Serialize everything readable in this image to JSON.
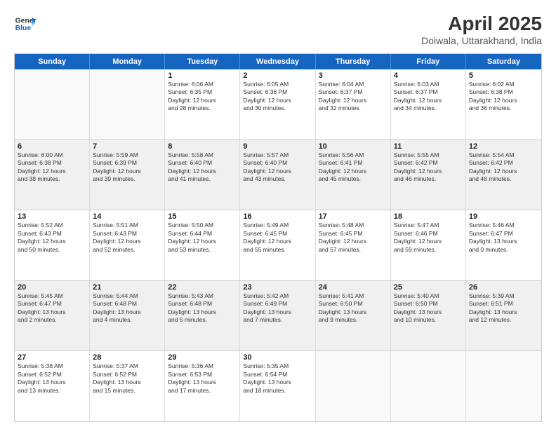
{
  "logo": {
    "line1": "General",
    "line2": "Blue"
  },
  "title": "April 2025",
  "subtitle": "Doiwala, Uttarakhand, India",
  "days": [
    "Sunday",
    "Monday",
    "Tuesday",
    "Wednesday",
    "Thursday",
    "Friday",
    "Saturday"
  ],
  "rows": [
    [
      {
        "day": "",
        "info": "",
        "empty": true
      },
      {
        "day": "",
        "info": "",
        "empty": true
      },
      {
        "day": "1",
        "info": "Sunrise: 6:06 AM\nSunset: 6:35 PM\nDaylight: 12 hours\nand 28 minutes."
      },
      {
        "day": "2",
        "info": "Sunrise: 6:05 AM\nSunset: 6:36 PM\nDaylight: 12 hours\nand 30 minutes."
      },
      {
        "day": "3",
        "info": "Sunrise: 6:04 AM\nSunset: 6:37 PM\nDaylight: 12 hours\nand 32 minutes."
      },
      {
        "day": "4",
        "info": "Sunrise: 6:03 AM\nSunset: 6:37 PM\nDaylight: 12 hours\nand 34 minutes."
      },
      {
        "day": "5",
        "info": "Sunrise: 6:02 AM\nSunset: 6:38 PM\nDaylight: 12 hours\nand 36 minutes."
      }
    ],
    [
      {
        "day": "6",
        "info": "Sunrise: 6:00 AM\nSunset: 6:38 PM\nDaylight: 12 hours\nand 38 minutes.",
        "shaded": true
      },
      {
        "day": "7",
        "info": "Sunrise: 5:59 AM\nSunset: 6:39 PM\nDaylight: 12 hours\nand 39 minutes.",
        "shaded": true
      },
      {
        "day": "8",
        "info": "Sunrise: 5:58 AM\nSunset: 6:40 PM\nDaylight: 12 hours\nand 41 minutes.",
        "shaded": true
      },
      {
        "day": "9",
        "info": "Sunrise: 5:57 AM\nSunset: 6:40 PM\nDaylight: 12 hours\nand 43 minutes.",
        "shaded": true
      },
      {
        "day": "10",
        "info": "Sunrise: 5:56 AM\nSunset: 6:41 PM\nDaylight: 12 hours\nand 45 minutes.",
        "shaded": true
      },
      {
        "day": "11",
        "info": "Sunrise: 5:55 AM\nSunset: 6:42 PM\nDaylight: 12 hours\nand 46 minutes.",
        "shaded": true
      },
      {
        "day": "12",
        "info": "Sunrise: 5:54 AM\nSunset: 6:42 PM\nDaylight: 12 hours\nand 48 minutes.",
        "shaded": true
      }
    ],
    [
      {
        "day": "13",
        "info": "Sunrise: 5:52 AM\nSunset: 6:43 PM\nDaylight: 12 hours\nand 50 minutes."
      },
      {
        "day": "14",
        "info": "Sunrise: 5:51 AM\nSunset: 6:43 PM\nDaylight: 12 hours\nand 52 minutes."
      },
      {
        "day": "15",
        "info": "Sunrise: 5:50 AM\nSunset: 6:44 PM\nDaylight: 12 hours\nand 53 minutes."
      },
      {
        "day": "16",
        "info": "Sunrise: 5:49 AM\nSunset: 6:45 PM\nDaylight: 12 hours\nand 55 minutes."
      },
      {
        "day": "17",
        "info": "Sunrise: 5:48 AM\nSunset: 6:45 PM\nDaylight: 12 hours\nand 57 minutes."
      },
      {
        "day": "18",
        "info": "Sunrise: 5:47 AM\nSunset: 6:46 PM\nDaylight: 12 hours\nand 59 minutes."
      },
      {
        "day": "19",
        "info": "Sunrise: 5:46 AM\nSunset: 6:47 PM\nDaylight: 13 hours\nand 0 minutes."
      }
    ],
    [
      {
        "day": "20",
        "info": "Sunrise: 5:45 AM\nSunset: 6:47 PM\nDaylight: 13 hours\nand 2 minutes.",
        "shaded": true
      },
      {
        "day": "21",
        "info": "Sunrise: 5:44 AM\nSunset: 6:48 PM\nDaylight: 13 hours\nand 4 minutes.",
        "shaded": true
      },
      {
        "day": "22",
        "info": "Sunrise: 5:43 AM\nSunset: 6:48 PM\nDaylight: 13 hours\nand 5 minutes.",
        "shaded": true
      },
      {
        "day": "23",
        "info": "Sunrise: 5:42 AM\nSunset: 6:49 PM\nDaylight: 13 hours\nand 7 minutes.",
        "shaded": true
      },
      {
        "day": "24",
        "info": "Sunrise: 5:41 AM\nSunset: 6:50 PM\nDaylight: 13 hours\nand 9 minutes.",
        "shaded": true
      },
      {
        "day": "25",
        "info": "Sunrise: 5:40 AM\nSunset: 6:50 PM\nDaylight: 13 hours\nand 10 minutes.",
        "shaded": true
      },
      {
        "day": "26",
        "info": "Sunrise: 5:39 AM\nSunset: 6:51 PM\nDaylight: 13 hours\nand 12 minutes.",
        "shaded": true
      }
    ],
    [
      {
        "day": "27",
        "info": "Sunrise: 5:38 AM\nSunset: 6:52 PM\nDaylight: 13 hours\nand 13 minutes."
      },
      {
        "day": "28",
        "info": "Sunrise: 5:37 AM\nSunset: 6:52 PM\nDaylight: 13 hours\nand 15 minutes."
      },
      {
        "day": "29",
        "info": "Sunrise: 5:36 AM\nSunset: 6:53 PM\nDaylight: 13 hours\nand 17 minutes."
      },
      {
        "day": "30",
        "info": "Sunrise: 5:35 AM\nSunset: 6:54 PM\nDaylight: 13 hours\nand 18 minutes."
      },
      {
        "day": "",
        "info": "",
        "empty": true
      },
      {
        "day": "",
        "info": "",
        "empty": true
      },
      {
        "day": "",
        "info": "",
        "empty": true
      }
    ]
  ]
}
